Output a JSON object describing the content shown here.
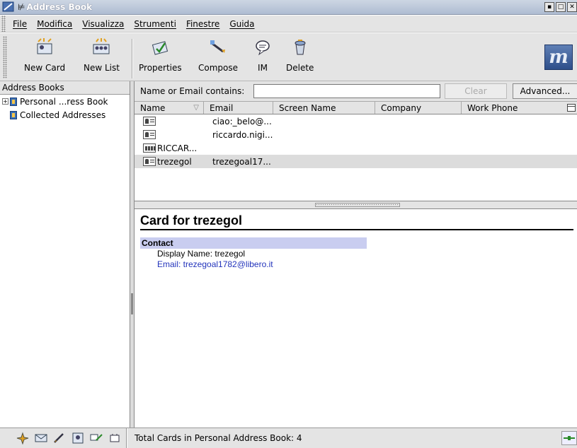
{
  "window": {
    "title": "Address Book"
  },
  "menubar": {
    "items": [
      "File",
      "Modifica",
      "Visualizza",
      "Strumenti",
      "Finestre",
      "Guida"
    ]
  },
  "toolbar": {
    "new_card": "New Card",
    "new_list": "New List",
    "properties": "Properties",
    "compose": "Compose",
    "im": "IM",
    "delete": "Delete"
  },
  "sidebar": {
    "header": "Address Books",
    "items": [
      {
        "label": "Personal ...ress Book",
        "expander": "+"
      },
      {
        "label": "Collected Addresses"
      }
    ]
  },
  "search": {
    "label": "Name or Email contains:",
    "value": "",
    "clear_label": "Clear",
    "advanced_label": "Advanced..."
  },
  "table": {
    "columns": [
      "Name",
      "Email",
      "Screen Name",
      "Company",
      "Work Phone"
    ],
    "rows": [
      {
        "type": "card",
        "name": "",
        "email": "ciao:_belo@..."
      },
      {
        "type": "card",
        "name": "",
        "email": "riccardo.nigi..."
      },
      {
        "type": "list",
        "name": "RICCAR...",
        "email": ""
      },
      {
        "type": "card",
        "name": "trezegol",
        "email": "trezegoal17...",
        "selected": true
      }
    ]
  },
  "card_view": {
    "title": "Card for trezegol",
    "section": "Contact",
    "display_name": "Display Name: trezegol",
    "email": "Email: trezegoal1782@libero.it"
  },
  "status": {
    "text": "Total Cards in Personal Address Book: 4"
  },
  "colors": {
    "section_bg": "#c9cdf0",
    "link": "#2233bb",
    "selected_row": "#dcdcdc"
  }
}
